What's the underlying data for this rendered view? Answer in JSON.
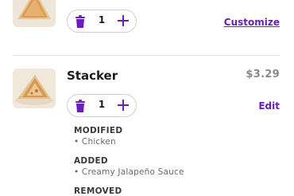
{
  "items": [
    {
      "quantity": "1",
      "action_label": "Customize"
    },
    {
      "name": "Stacker",
      "price": "$3.29",
      "quantity": "1",
      "action_label": "Edit",
      "modifications": [
        {
          "heading": "MODIFIED",
          "entries": [
            "• Chicken"
          ]
        },
        {
          "heading": "ADDED",
          "entries": [
            "• Creamy Jalapeño Sauce"
          ]
        },
        {
          "heading": "REMOVED",
          "entries": []
        }
      ]
    }
  ],
  "icons": {
    "trash": "trash-icon",
    "plus": "plus-icon"
  },
  "colors": {
    "accent": "#6a1fb8",
    "price": "#8a8a8a"
  }
}
